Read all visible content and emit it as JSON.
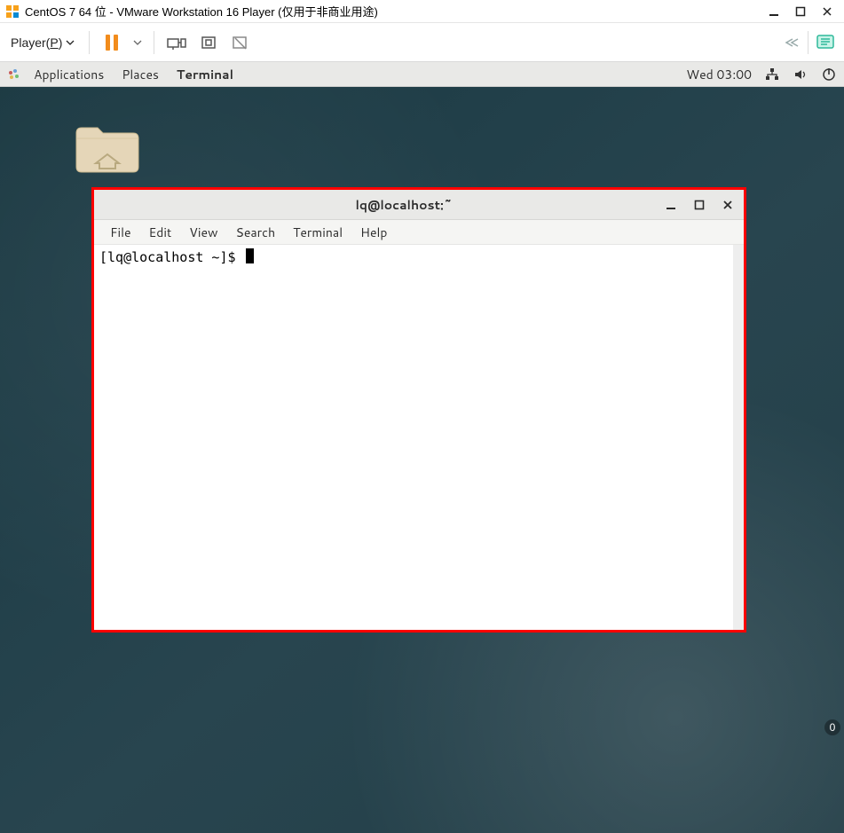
{
  "vmware": {
    "title": "CentOS 7 64 位 - VMware Workstation 16 Player (仅用于非商业用途)",
    "player_menu_label": "Player(",
    "player_menu_hotkey": "P",
    "player_menu_suffix": ")"
  },
  "gnome": {
    "menu_applications": "Applications",
    "menu_places": "Places",
    "menu_terminal": "Terminal",
    "clock": "Wed 03:00"
  },
  "terminal": {
    "title": "lq@localhost:~",
    "menus": {
      "file": "File",
      "edit": "Edit",
      "view": "View",
      "search": "Search",
      "terminal": "Terminal",
      "help": "Help"
    },
    "prompt": "[lq@localhost ~]$ "
  },
  "osd": {
    "badge": "0"
  }
}
